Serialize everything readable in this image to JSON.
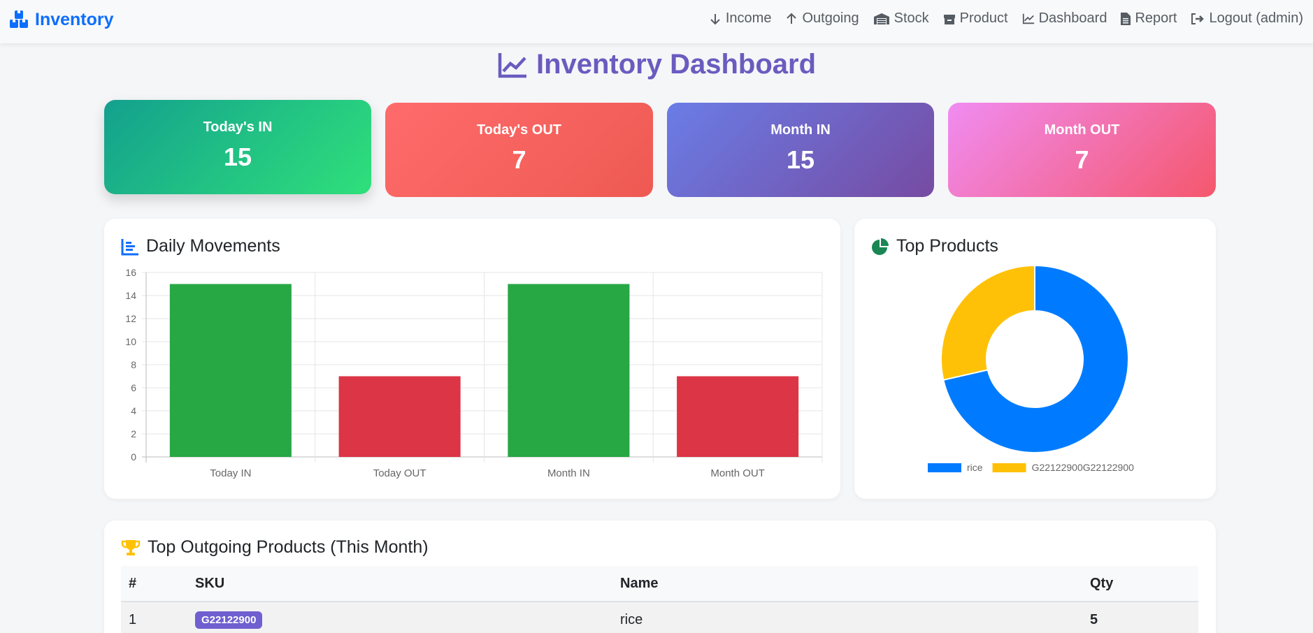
{
  "navbar": {
    "brand": "Inventory",
    "items": [
      {
        "label": "Income",
        "icon": "arrow-down-icon"
      },
      {
        "label": "Outgoing",
        "icon": "arrow-up-icon"
      },
      {
        "label": "Stock",
        "icon": "warehouse-icon"
      },
      {
        "label": "Product",
        "icon": "box-icon"
      },
      {
        "label": "Dashboard",
        "icon": "chart-line-icon"
      },
      {
        "label": "Report",
        "icon": "file-icon"
      },
      {
        "label": "Logout (admin)",
        "icon": "logout-icon"
      }
    ]
  },
  "page_title": "Inventory Dashboard",
  "stats": [
    {
      "label": "Today's IN",
      "value": "15"
    },
    {
      "label": "Today's OUT",
      "value": "7"
    },
    {
      "label": "Month IN",
      "value": "15"
    },
    {
      "label": "Month OUT",
      "value": "7"
    }
  ],
  "daily_movements": {
    "title": "Daily Movements"
  },
  "top_products": {
    "title": "Top Products"
  },
  "chart_data": [
    {
      "type": "bar",
      "categories": [
        "Today IN",
        "Today OUT",
        "Month IN",
        "Month OUT"
      ],
      "values": [
        15,
        7,
        15,
        7
      ],
      "colors": [
        "#28a745",
        "#dc3545",
        "#28a745",
        "#dc3545"
      ],
      "ylim": [
        0,
        16
      ],
      "yticks": [
        0,
        2,
        4,
        6,
        8,
        10,
        12,
        14,
        16
      ],
      "grid": true,
      "xlabel": "",
      "ylabel": ""
    },
    {
      "type": "pie",
      "donut": true,
      "labels": [
        "rice",
        "G22122900G22122900"
      ],
      "values": [
        5,
        2
      ],
      "colors": [
        "#007bff",
        "#ffc107"
      ],
      "legend": "bottom"
    }
  ],
  "top_outgoing": {
    "title": "Top Outgoing Products (This Month)",
    "headers": [
      "#",
      "SKU",
      "Name",
      "Qty"
    ],
    "rows": [
      {
        "rank": "1",
        "sku": "G22122900",
        "name": "rice",
        "qty": "5"
      }
    ]
  }
}
